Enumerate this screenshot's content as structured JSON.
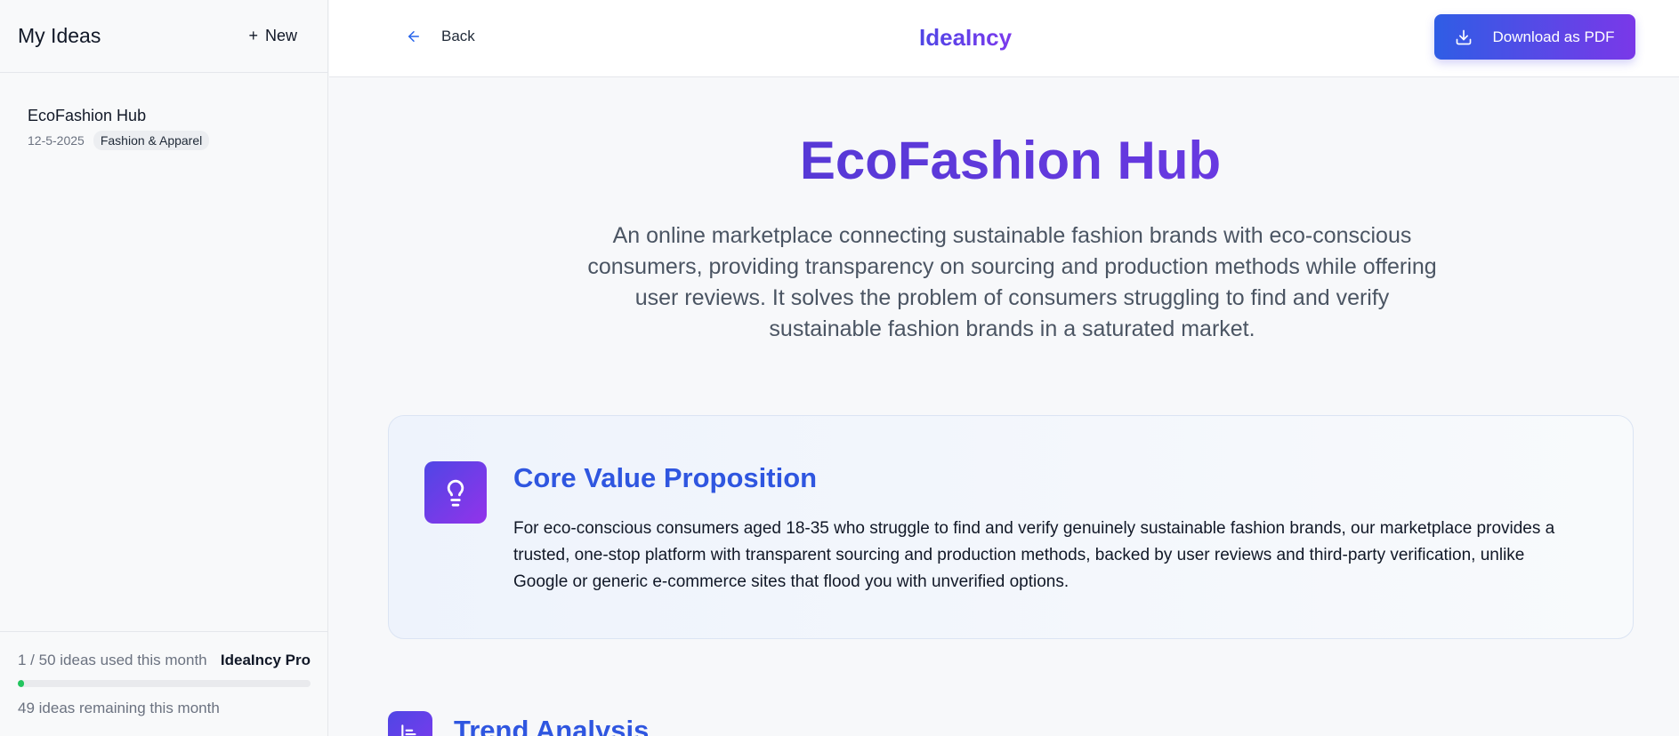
{
  "sidebar": {
    "title": "My Ideas",
    "new_label": "New",
    "ideas": [
      {
        "name": "EcoFashion Hub",
        "date": "12-5-2025",
        "category": "Fashion & Apparel"
      }
    ],
    "usage": {
      "text": "1 / 50 ideas used this month",
      "plan": "IdeaIncy Pro",
      "used": 1,
      "limit": 50,
      "remaining_text": "49 ideas remaining this month"
    }
  },
  "topbar": {
    "back_label": "Back",
    "brand": "IdeaIncy",
    "download_label": "Download as PDF"
  },
  "main": {
    "title": "EcoFashion Hub",
    "description": "An online marketplace connecting sustainable fashion brands with eco-conscious consumers, providing transparency on sourcing and production methods while offering user reviews. It solves the problem of consumers struggling to find and verify sustainable fashion brands in a saturated market.",
    "sections": [
      {
        "title": "Core Value Proposition",
        "icon": "lightbulb-icon",
        "body": "For eco-conscious consumers aged 18-35 who struggle to find and verify genuinely sustainable fashion brands, our marketplace provides a trusted, one-stop platform with transparent sourcing and production methods, backed by user reviews and third-party verification, unlike Google or generic e-commerce sites that flood you with unverified options."
      },
      {
        "title": "Trend Analysis",
        "icon": "chart-bars-icon"
      }
    ]
  },
  "colors": {
    "accent_blue": "#2f56e0",
    "accent_purple": "#7c3aed",
    "progress_green": "#22c55e"
  }
}
